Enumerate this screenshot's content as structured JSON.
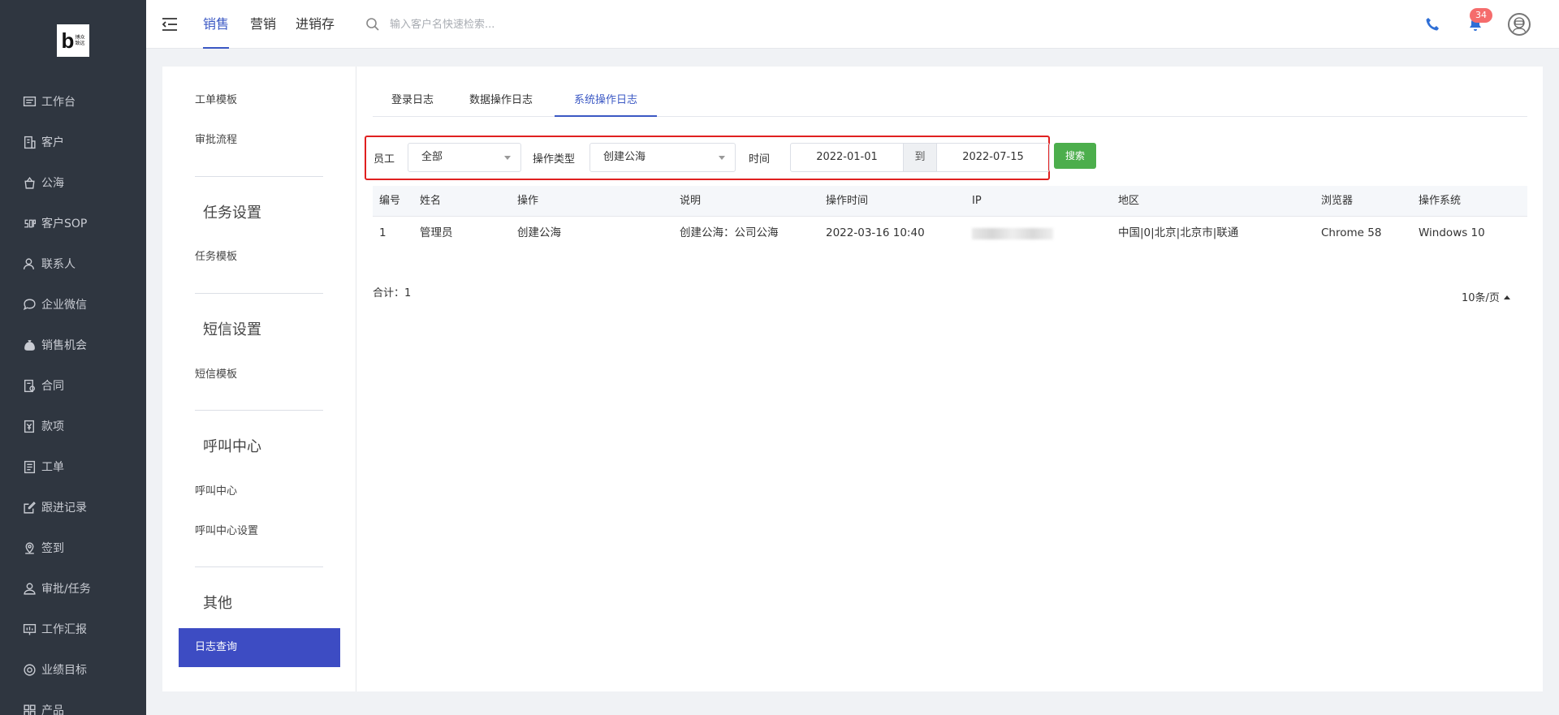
{
  "app": {
    "logo_text_line1": "博众",
    "logo_text_line2": "致远"
  },
  "topbar": {
    "tabs": [
      {
        "label": "销售",
        "active": true
      },
      {
        "label": "营销",
        "active": false
      },
      {
        "label": "进销存",
        "active": false
      }
    ],
    "search_placeholder": "输入客户名快速检索...",
    "notification_count": "34",
    "accent_color": "#3b58c4"
  },
  "sidebar": {
    "items": [
      {
        "label": "工作台",
        "icon": "monitor-icon"
      },
      {
        "label": "客户",
        "icon": "building-icon"
      },
      {
        "label": "公海",
        "icon": "pool-icon"
      },
      {
        "label": "客户SOP",
        "icon": "sop-icon"
      },
      {
        "label": "联系人",
        "icon": "contact-icon"
      },
      {
        "label": "企业微信",
        "icon": "chat-icon"
      },
      {
        "label": "销售机会",
        "icon": "money-bag-icon"
      },
      {
        "label": "合同",
        "icon": "contract-icon"
      },
      {
        "label": "款项",
        "icon": "payment-icon"
      },
      {
        "label": "工单",
        "icon": "ticket-icon"
      },
      {
        "label": "跟进记录",
        "icon": "edit-icon"
      },
      {
        "label": "签到",
        "icon": "location-icon"
      },
      {
        "label": "审批/任务",
        "icon": "approval-icon"
      },
      {
        "label": "工作汇报",
        "icon": "report-icon"
      },
      {
        "label": "业绩目标",
        "icon": "target-icon"
      },
      {
        "label": "产品",
        "icon": "product-icon"
      }
    ]
  },
  "settings_nav": {
    "item_ticket_template": "工单模板",
    "item_approval_flow": "审批流程",
    "group_task": "任务设置",
    "item_task_template": "任务模板",
    "group_sms": "短信设置",
    "item_sms_template": "短信模板",
    "group_call": "呼叫中心",
    "item_call_center": "呼叫中心",
    "item_call_center_settings": "呼叫中心设置",
    "group_other": "其他",
    "item_log_query": "日志查询"
  },
  "log_tabs": [
    {
      "label": "登录日志",
      "active": false
    },
    {
      "label": "数据操作日志",
      "active": false
    },
    {
      "label": "系统操作日志",
      "active": true
    }
  ],
  "filter": {
    "employee_label": "员工",
    "employee_value": "全部",
    "op_type_label": "操作类型",
    "op_type_value": "创建公海",
    "time_label": "时间",
    "date_from": "2022-01-01",
    "date_sep": "到",
    "date_to": "2022-07-15",
    "search_label": "搜索",
    "search_color": "#4cae4c",
    "highlight_color": "#e02020"
  },
  "table": {
    "columns": [
      "编号",
      "姓名",
      "操作",
      "说明",
      "操作时间",
      "IP",
      "地区",
      "浏览器",
      "操作系统"
    ],
    "rows": [
      [
        "1",
        "管理员",
        "创建公海",
        "创建公海：公司公海",
        "2022-03-16 10:40",
        "",
        "中国|0|北京|北京市|联通",
        "Chrome 58",
        "Windows 10"
      ]
    ]
  },
  "footer": {
    "total_text": "合计：1",
    "page_size": "10条/页"
  }
}
